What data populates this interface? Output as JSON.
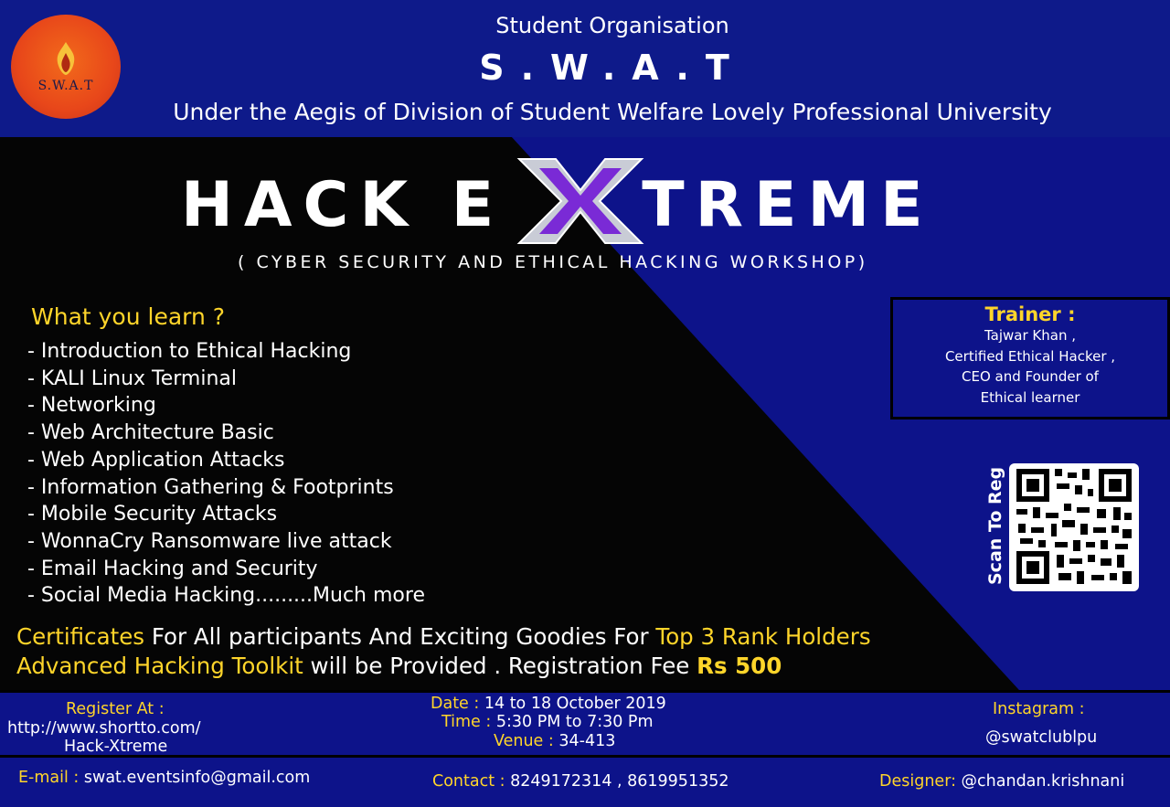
{
  "header": {
    "org": "Student Organisation",
    "name": "S.W.A.T",
    "aegis": "Under the Aegis of Division of Student Welfare Lovely Professional University",
    "logo_text": "S.W.A.T"
  },
  "title": {
    "left": "HACK E",
    "x": "X",
    "right": "TREME",
    "subtitle": "( CYBER SECURITY AND ETHICAL HACKING  WORKSHOP)"
  },
  "learn": {
    "heading": "What you learn ?",
    "items": [
      "- Introduction to Ethical Hacking",
      "- KALI Linux Terminal",
      "- Networking",
      "- Web Architecture Basic",
      "- Web Application Attacks",
      "- Information Gathering & Footprints",
      "- Mobile Security Attacks",
      "- WonnaCry Ransomware live attack",
      "- Email Hacking and Security",
      "- Social Media Hacking.........Much more"
    ]
  },
  "trainer": {
    "heading": "Trainer :",
    "lines": [
      "Tajwar Khan ,",
      "Certified Ethical Hacker ,",
      "CEO and Founder of",
      "Ethical learner"
    ]
  },
  "qr": {
    "label": "Scan To Reg"
  },
  "perks": {
    "certificates": "Certificates",
    "for_all": " For All participants And Exciting Goodies For ",
    "top3": "Top 3 Rank Holders",
    "toolkit": "Advanced Hacking Toolkit",
    "provided": " will be Provided .  Registration Fee ",
    "fee": "Rs 500"
  },
  "footer": {
    "register_label": "Register At :",
    "register_url1": "http://www.shortto.com/",
    "register_url2": "Hack-Xtreme",
    "date_label": "Date :",
    "date_value": " 14 to 18 October 2019",
    "time_label": "Time :",
    "time_value": " 5:30 PM to 7:30 Pm",
    "venue_label": "Venue :",
    "venue_value": " 34-413",
    "instagram_label": "Instagram :",
    "instagram_value": "@swatclublpu",
    "email_label": "E-mail :",
    "email_value": " swat.eventsinfo@gmail.com",
    "contact_label": "Contact :",
    "contact_value": " 8249172314 , 8619951352",
    "designer_label": "Designer:",
    "designer_value": " @chandan.krishnani"
  },
  "colors": {
    "navy": "#0d138a",
    "accent_yellow": "#ffd52a",
    "logo_orange": "#e8471a",
    "x_purple": "#7a2ad6"
  }
}
